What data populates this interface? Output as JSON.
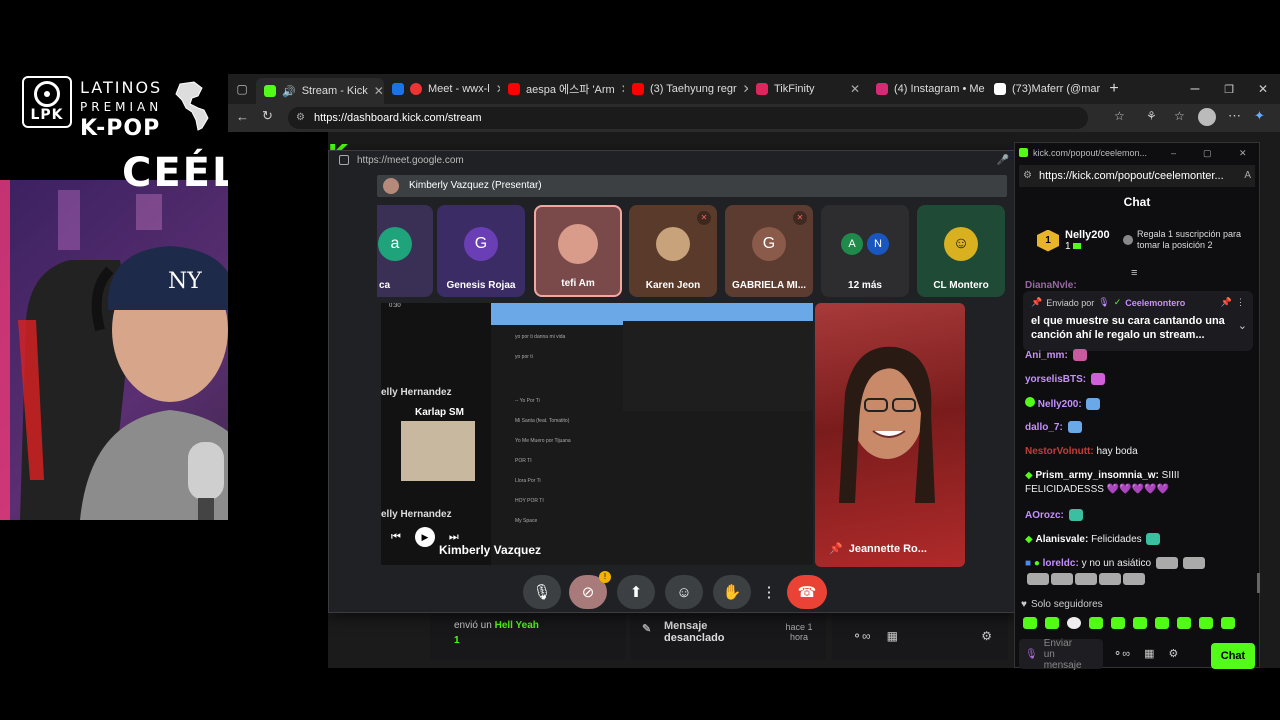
{
  "overlay": {
    "logo_text": "LPK",
    "brand_line1": "LATINOS",
    "brand_line2": "PREMIAN",
    "brand_line3": "K-POP",
    "streamer_name": "CEÉLE"
  },
  "browser": {
    "tabs": [
      {
        "label": "Stream - Kick",
        "color": "#53fc18"
      },
      {
        "label": "Meet - wwx-l",
        "color": "#1a73e8"
      },
      {
        "label": "aespa 에스파 'Arm",
        "color": "#ff0000"
      },
      {
        "label": "(3) Taehyung regr",
        "color": "#ff0000"
      },
      {
        "label": "TikFinity",
        "color": "#e0245e"
      },
      {
        "label": "(4) Instagram • Me",
        "color": "#d62976"
      },
      {
        "label": "(73)Maferr (@mar",
        "color": "#ffffff"
      }
    ],
    "url": "https://dashboard.kick.com/stream"
  },
  "meet": {
    "url": "https://meet.google.com",
    "presenter_bar": "Kimberly Vazquez (Presentar)",
    "participants": [
      {
        "name": "ca",
        "initial": "a",
        "avatar_color": "#1fa37a",
        "bg": "#3a2f55"
      },
      {
        "name": "Genesis Rojaa",
        "initial": "G",
        "avatar_color": "#6a3fb5",
        "bg": "#3b2c66"
      },
      {
        "name": "tefi Am",
        "initial": "",
        "avatar_color": "#d99b8a",
        "bg": "#7a4a4a"
      },
      {
        "name": "Karen Jeon",
        "initial": "",
        "avatar_color": "#c7a27a",
        "bg": "#5a3a2a"
      },
      {
        "name": "GABRIELA MI...",
        "initial": "G",
        "avatar_color": "#8a5a4a",
        "bg": "#5c3b30"
      },
      {
        "name": "12 más",
        "initial": "",
        "avatar_color": "#1f8a4a",
        "bg": "#2d2d30"
      },
      {
        "name": "CL Montero",
        "initial": "",
        "avatar_color": "#d8b020",
        "bg": "#1f4a36"
      }
    ],
    "more_initials": [
      "A",
      "N"
    ],
    "screen_labels": {
      "karlap": "Karlap SM",
      "presenter_overlay": "Kimberly Vazquez",
      "nelly_top": "elly Hernandez",
      "nelly_bottom": "elly Hernandez"
    },
    "spotify_rows": [
      "yo por ti danna mi vida",
      "yo por ti",
      "-- Yo Por Ti",
      "Mi Santa (feat. Tomatito)",
      "Yo Me Muero por Tijuana",
      "POR TI",
      "Llora Por Ti",
      "HOY POR TI",
      "My Space"
    ],
    "right_tile_name": "Jeannette Ro..."
  },
  "kick": {
    "logo": "KICK",
    "bottom_user": "envió un",
    "bottom_gift": "Hell Yeah",
    "bottom_count": "1",
    "unpinned_label_1": "Mensaje",
    "unpinned_label_2": "desanclado",
    "unpinned_time": "hace 1 hora"
  },
  "chat": {
    "window_title": "kick.com/popout/ceelemon...",
    "url": "https://kick.com/popout/ceelemonter...",
    "header": "Chat",
    "top_gifter": "Nelly200",
    "top_gifter_count": "1",
    "gift_prompt": "Regala 1 suscripción para tomar la posición 2",
    "pinned_by_label": "Enviado por",
    "pinned_by_user": "Ceelemontero",
    "pinned_text": "el que muestre su cara cantando una canción ahí le regalo un stream...",
    "messages": [
      {
        "user": "DianaNvle:",
        "text": "",
        "color": "#f0a3ff"
      },
      {
        "user": "Ani_mm:",
        "text": "",
        "color": "#c490ff"
      },
      {
        "user": "yorselisBTS:",
        "text": "",
        "color": "#c490ff"
      },
      {
        "user": "Nelly200:",
        "text": "",
        "color": "#c490ff"
      },
      {
        "user": "dallo_7:",
        "text": "",
        "color": "#c490ff"
      },
      {
        "user": "NestorVolnutt:",
        "text": "hay boda",
        "color": "#c43b3b"
      },
      {
        "user": "Prism_army_insomnia_w:",
        "text": "SIIII FELICIDADESSS",
        "color": "#ffffff"
      },
      {
        "user": "AOrozc:",
        "text": "",
        "color": "#c490ff"
      },
      {
        "user": "Alanisvale:",
        "text": "Felicidades",
        "color": "#ffffff"
      },
      {
        "user": "loreldc:",
        "text": "y no un asiático",
        "color": "#c490ff"
      }
    ],
    "followers_only": "Solo seguidores",
    "input_placeholder": "Enviar un mensaje",
    "send_button": "Chat"
  }
}
